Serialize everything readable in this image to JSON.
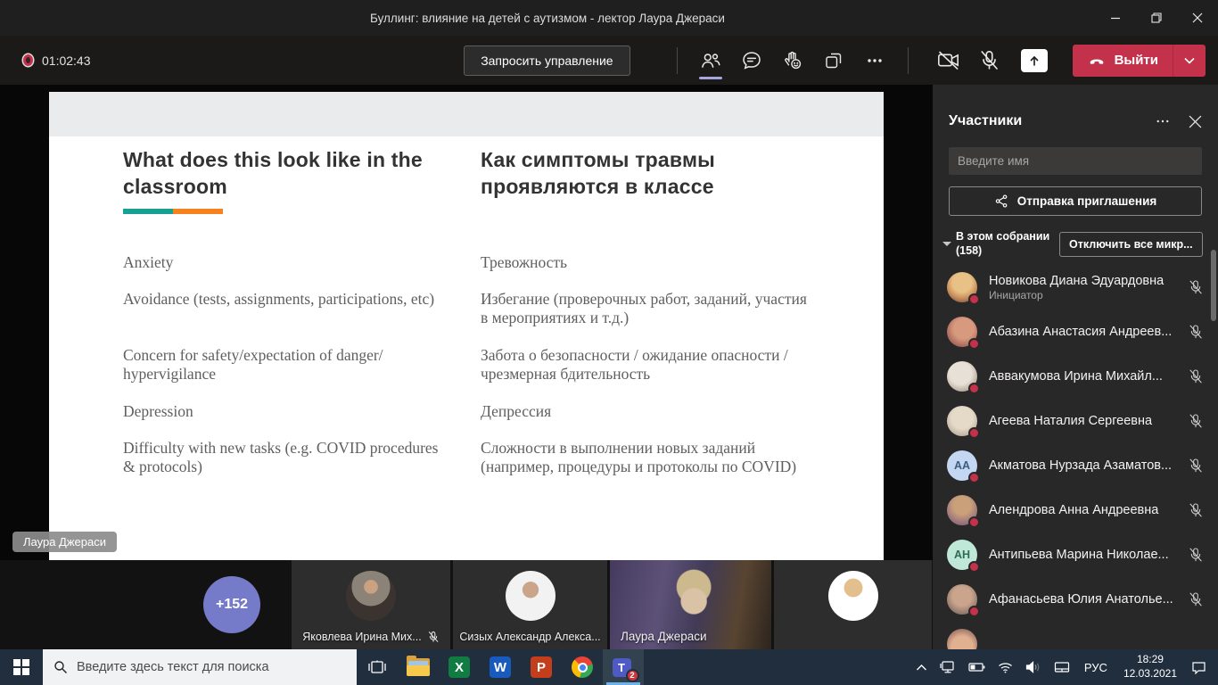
{
  "window": {
    "title": "Буллинг: влияние на детей с аутизмом - лектор Лаура Джераси"
  },
  "toolbar": {
    "timer": "01:02:43",
    "request_control": "Запросить управление",
    "leave": "Выйти"
  },
  "slide": {
    "heading_en": "What does this look like in the\nclassroom",
    "heading_ru": "Как симптомы травмы\nпроявляются в классе",
    "accent_teal": "#18a094",
    "accent_orange": "#f5821f",
    "rows": [
      {
        "en": "Anxiety",
        "ru": "Тревожность"
      },
      {
        "en": "Avoidance (tests, assignments, participations, etc)",
        "ru": "Избегание (проверочных работ, заданий, участия\nв мероприятиях и т.д.)"
      },
      {
        "en": "Concern for safety/expectation of danger/\nhypervigilance",
        "ru": "Забота о безопасности / ожидание опасности /\nчрезмерная бдительность"
      },
      {
        "en": "Depression",
        "ru": "Депрессия"
      },
      {
        "en": "Difficulty with new tasks (e.g. COVID procedures\n& protocols)",
        "ru": "Сложности в выполнении новых заданий\n(например, процедуры и протоколы по COVID)"
      }
    ]
  },
  "presenter_badge": "Лаура Джераси",
  "filmstrip": {
    "overflow_badge": "+152",
    "tiles": [
      {
        "name": "Яковлева Ирина Мих...",
        "muted": true
      },
      {
        "name": "Сизых Александр Алекса..."
      },
      {
        "name": "Лаура Джераси",
        "video": true
      },
      {
        "name": ""
      }
    ]
  },
  "panel": {
    "title": "Участники",
    "search_placeholder": "Введите имя",
    "invite": "Отправка приглашения",
    "section_label": "В этом собрании\n(158)",
    "mute_all": "Отключить все микр...",
    "participants": [
      {
        "name": "Новикова Диана Эдуардовна",
        "role": "Инициатор"
      },
      {
        "name": "Абазина Анастасия Андреев..."
      },
      {
        "name": "Аввакумова Ирина Михайл..."
      },
      {
        "name": "Агеева Наталия Сергеевна"
      },
      {
        "name": "Акматова Нурзада Азаматов...",
        "initials": "АА",
        "avatar_style": "background:#c3d7f2;color:#3f5a83"
      },
      {
        "name": "Алендрова Анна Андреевна"
      },
      {
        "name": "Антипьева Марина Николае...",
        "initials": "АН",
        "avatar_style": "background:#bfe8d9;color:#2f6b57"
      },
      {
        "name": "Афанасьева Юлия Анатолье..."
      }
    ]
  },
  "taskbar": {
    "search_placeholder": "Введите здесь текст для поиска",
    "teams_badge": "2",
    "language": "РУС",
    "time": "18:29",
    "date": "12.03.2021"
  }
}
